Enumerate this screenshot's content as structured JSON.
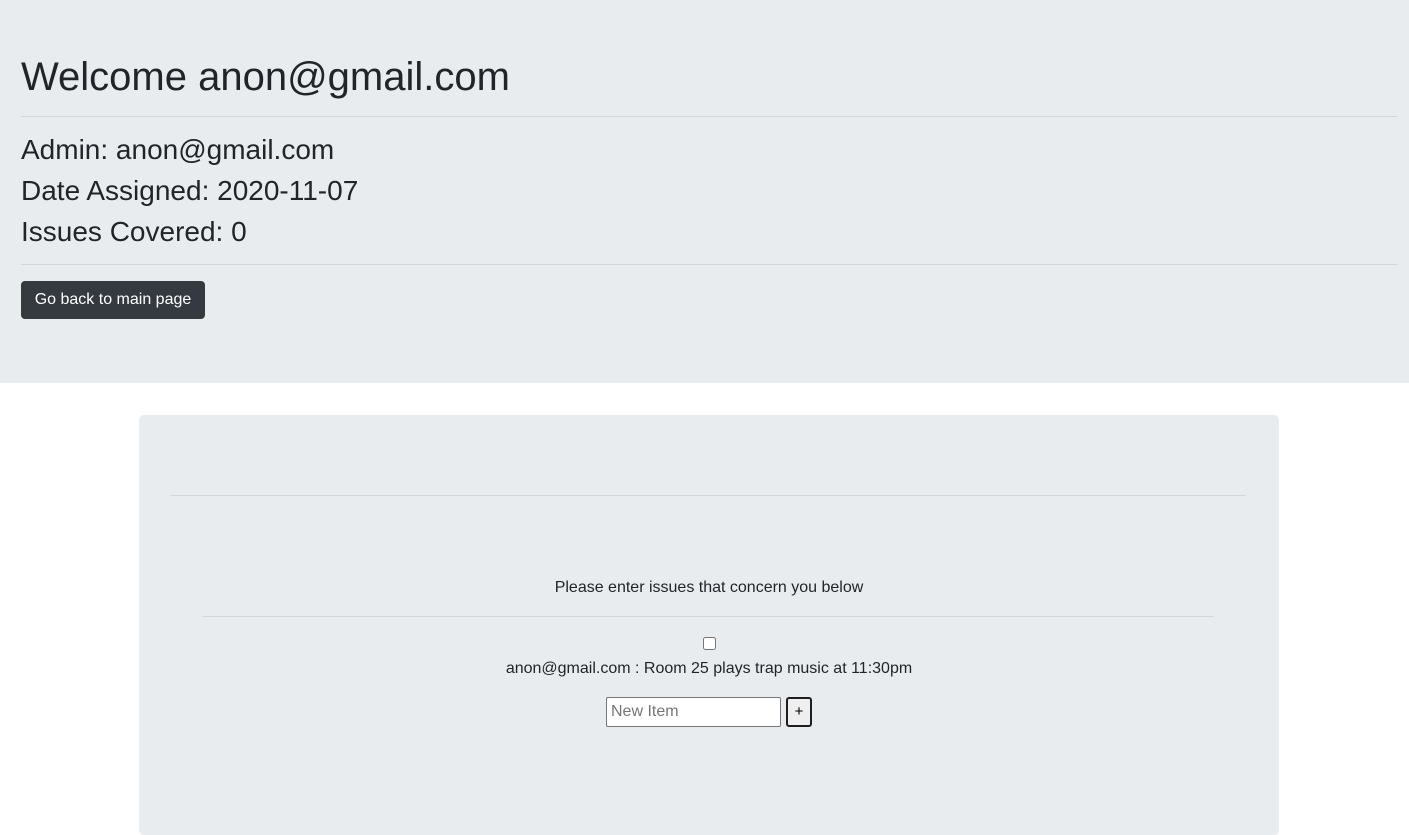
{
  "header": {
    "welcome": "Welcome anon@gmail.com",
    "admin": "Admin: anon@gmail.com",
    "date_assigned": "Date Assigned: 2020-11-07",
    "issues_covered": "Issues Covered: 0",
    "back_button_label": "Go back to main page"
  },
  "issues": {
    "prompt": "Please enter issues that concern you below",
    "items": [
      {
        "text": "anon@gmail.com : Room 25 plays trap music at 11:30pm",
        "checked": false
      }
    ],
    "new_item_placeholder": "New Item",
    "new_item_value": "",
    "add_button_label": "+"
  },
  "colors": {
    "panel_background": "#e9ecef",
    "button_dark": "#343a40"
  }
}
